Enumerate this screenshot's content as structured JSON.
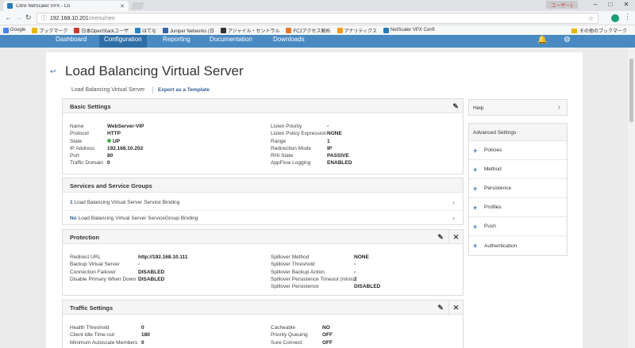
{
  "browser": {
    "tab_title": "Citrix NetScaler VPX - Co",
    "profile_chip": "ユーザー1",
    "window_controls": [
      "–",
      "□",
      "✕"
    ],
    "url_host": "192.168.10.201",
    "url_path": "/menu/neo",
    "bookmarks": [
      {
        "label": "Google",
        "color": "#4285f4"
      },
      {
        "label": "ブックマーク",
        "color": "#e8b900"
      },
      {
        "label": "日本OpenStackユーザ",
        "color": "#c93a2e"
      },
      {
        "label": "はてな",
        "color": "#2a84c6"
      },
      {
        "label": "Juniper Networks (日",
        "color": "#3565a9"
      },
      {
        "label": "アジャイル・セントラル",
        "color": "#333333"
      },
      {
        "label": "FC2アクセス解析",
        "color": "#e6792a"
      },
      {
        "label": "アナリティクス",
        "color": "#f39c12"
      },
      {
        "label": "NetScaler VPX Confi",
        "color": "#2a7ab8"
      }
    ],
    "other_bookmarks": "その他のブックマーク"
  },
  "appnav": {
    "items": [
      "Dashboard",
      "Configuration",
      "Reporting",
      "Documentation",
      "Downloads"
    ],
    "active": "Configuration"
  },
  "page": {
    "title": "Load Balancing Virtual Server",
    "breadcrumb": "Load Balancing Virtual Server",
    "export_link": "Export as a Template"
  },
  "basic": {
    "header": "Basic Settings",
    "left": [
      {
        "k": "Name",
        "v": "WebServer-VIP"
      },
      {
        "k": "Protocol",
        "v": "HTTP"
      },
      {
        "k": "State",
        "v": "UP"
      },
      {
        "k": "IP Address",
        "v": "192.168.10.202"
      },
      {
        "k": "Port",
        "v": "80"
      },
      {
        "k": "Traffic Domain",
        "v": "0"
      }
    ],
    "right": [
      {
        "k": "Listen Priority",
        "v": "-"
      },
      {
        "k": "Listen Policy Expression",
        "v": "NONE"
      },
      {
        "k": "Range",
        "v": "1"
      },
      {
        "k": "Redirection Mode",
        "v": "IP"
      },
      {
        "k": "RHI State",
        "v": "PASSIVE"
      },
      {
        "k": "AppFlow Logging",
        "v": "ENABLED"
      }
    ],
    "state_color": "#4caf50"
  },
  "services": {
    "header": "Services and Service Groups",
    "row1_count": "1",
    "row1_text": "Load Balancing Virtual Server Service Binding",
    "row2_count": "No",
    "row2_text": "Load Balancing Virtual Server ServiceGroup Binding"
  },
  "protection": {
    "header": "Protection",
    "left": [
      {
        "k": "Redirect URL",
        "v": "http://192.168.10.111"
      },
      {
        "k": "Backup Virtual Server",
        "v": "-"
      },
      {
        "k": "Connection Failover",
        "v": "DISABLED"
      },
      {
        "k": "Disable Primary When Down",
        "v": "DISABLED"
      }
    ],
    "right": [
      {
        "k": "Spillover Method",
        "v": "NONE"
      },
      {
        "k": "Spillover Threshold",
        "v": "-"
      },
      {
        "k": "Spillover Backup Action",
        "v": "-"
      },
      {
        "k": "Spillover Persistence Timeout (mins)",
        "v": "2"
      },
      {
        "k": "Spillover Persistence",
        "v": "DISABLED"
      }
    ]
  },
  "traffic": {
    "header": "Traffic Settings",
    "left": [
      {
        "k": "Health Threshold",
        "v": "0"
      },
      {
        "k": "Client Idle Time-out",
        "v": "180"
      },
      {
        "k": "Minimum Autoscale Members",
        "v": "0"
      }
    ],
    "right": [
      {
        "k": "Cacheable",
        "v": "NO"
      },
      {
        "k": "Priority Queuing",
        "v": "OFF"
      },
      {
        "k": "Sure Connect",
        "v": "OFF"
      }
    ]
  },
  "side": {
    "help": "Help",
    "advanced": "Advanced Settings",
    "items": [
      "Policies",
      "Method",
      "Persistence",
      "Profiles",
      "Push",
      "Authentication"
    ]
  }
}
